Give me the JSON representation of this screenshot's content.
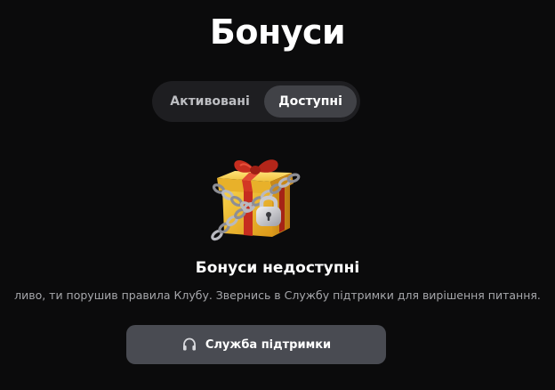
{
  "page": {
    "title": "Бонуси"
  },
  "tabs": [
    {
      "label": "Активовані",
      "selected": false
    },
    {
      "label": "Доступні",
      "selected": true
    }
  ],
  "illustration": {
    "icon": "locked-gift-icon"
  },
  "status": {
    "title": "Бонуси недоступні",
    "message": "ливо, ти порушив правила Клубу. Звернись в Службу підтримки для вирішення питання."
  },
  "support_button": {
    "icon": "headset-icon",
    "label": "Служба підтримки"
  },
  "colors": {
    "background": "#0b0b0c",
    "tab_bar": "#1e1e21",
    "tab_selected": "#414247",
    "button": "#494b52",
    "muted_text": "#a6a7ab",
    "gift_gold": "#f2bd2e",
    "ribbon_red": "#c62d1f"
  }
}
